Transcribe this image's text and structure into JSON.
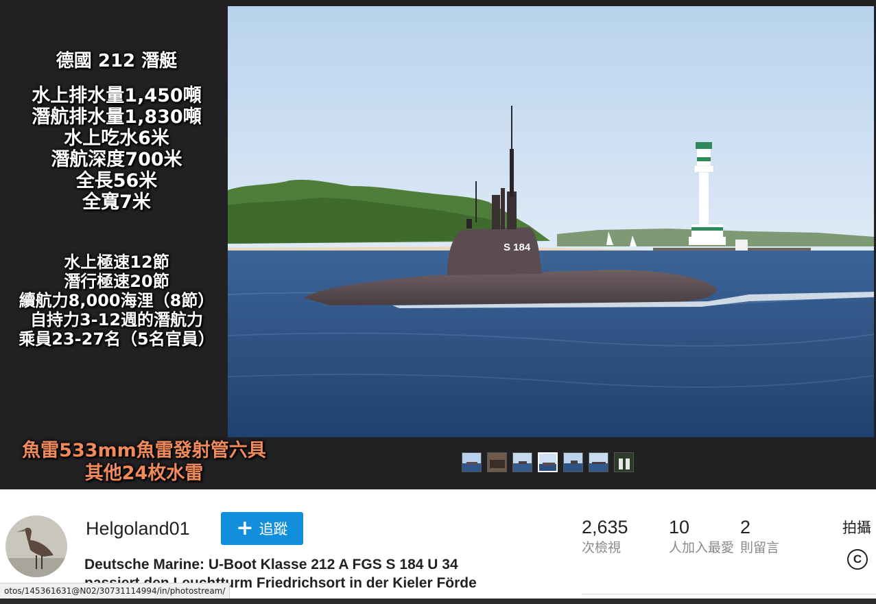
{
  "overlay": {
    "title": "德國 212  潛艇",
    "specs_block1": [
      "水上排水量1,450噸",
      "潛航排水量1,830噸",
      "水上吃水6米",
      "潛航深度700米",
      "全長56米",
      "全寬7米"
    ],
    "specs_block2": [
      "水上極速12節",
      "潛行極速20節",
      "續航力8,000海浬（8節）",
      "自持力3-12週的潛航力",
      "乘員23-27名（5名官員）"
    ],
    "weapons": [
      "魚雷533mm魚雷發射管六具",
      "其他24枚水雷"
    ],
    "weapons_color": "#f08a5a"
  },
  "photo": {
    "hull_number": "S 184",
    "sky_color": "#cfe1f3",
    "sea_color": "#2a4f80"
  },
  "thumbnails": {
    "count": 7,
    "active_index": 3
  },
  "owner": {
    "username": "Helgoland01",
    "follow_label": "追蹤",
    "follow_color": "#128fdc"
  },
  "photo_title": "Deutsche Marine: U-Boot Klasse 212 A FGS S 184 U 34 passiert den Leuchtturm Friedrichsort in der Kieler Förde",
  "stats": {
    "views": {
      "value": "2,635",
      "label": "次檢視"
    },
    "faves": {
      "value": "10",
      "label": "人加入最愛"
    },
    "comments": {
      "value": "2",
      "label": "則留言"
    }
  },
  "camera_label": "拍攝",
  "license_icon": "copyright-icon",
  "status_url": "otos/145361631@N02/30731114994/in/photostream/"
}
